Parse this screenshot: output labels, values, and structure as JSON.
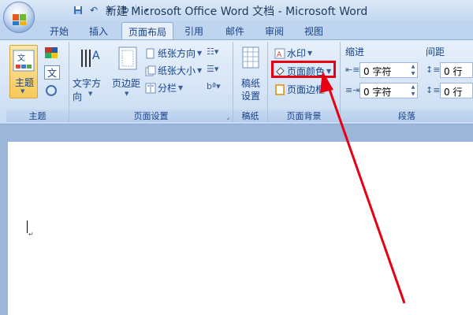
{
  "window": {
    "title": "新建 Microsoft Office Word 文档 - Microsoft Word"
  },
  "qat": {
    "save": "save-icon",
    "undo": "undo-icon",
    "redo": "redo-icon"
  },
  "tabs": [
    {
      "label": "开始"
    },
    {
      "label": "插入"
    },
    {
      "label": "页面布局",
      "active": true
    },
    {
      "label": "引用"
    },
    {
      "label": "邮件"
    },
    {
      "label": "审阅"
    },
    {
      "label": "视图"
    }
  ],
  "ribbon": {
    "theme": {
      "button": "主题",
      "label": "主题"
    },
    "page_setup": {
      "text_direction": "文字方向",
      "margins": "页边距",
      "orientation": "纸张方向",
      "size": "纸张大小",
      "columns": "分栏",
      "label": "页面设置"
    },
    "draft_paper": {
      "button": "稿纸\n设置",
      "line1": "稿纸",
      "line2": "设置",
      "label": "稿纸"
    },
    "page_background": {
      "watermark": "水印",
      "page_color": "页面颜色",
      "page_borders": "页面边框",
      "label": "页面背景"
    },
    "paragraph": {
      "indent_title": "缩进",
      "spacing_title": "间距",
      "indent_left": "0 字符",
      "indent_right": "0 字符",
      "spacing_before": "0 行",
      "spacing_after": "0 行",
      "label": "段落"
    }
  },
  "colors": {
    "highlight": "#e60012",
    "annotation_arrow": "#e60012"
  }
}
